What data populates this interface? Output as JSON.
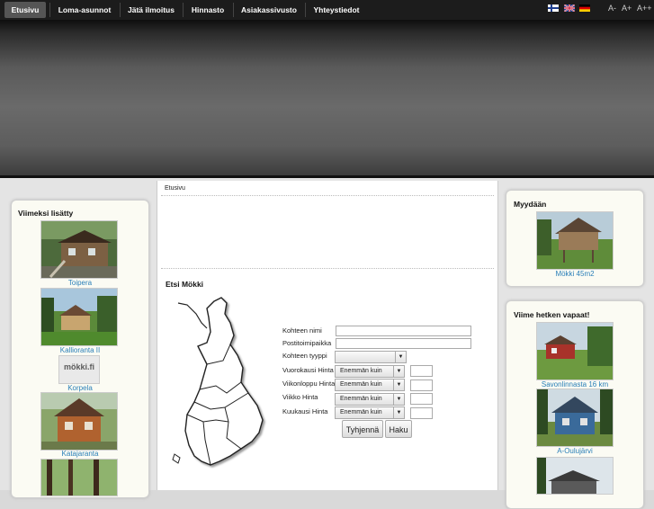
{
  "nav": {
    "items": [
      {
        "label": "Etusivu"
      },
      {
        "label": "Loma-asunnot"
      },
      {
        "label": "Jätä ilmoitus"
      },
      {
        "label": "Hinnasto"
      },
      {
        "label": "Asiakassivusto"
      },
      {
        "label": "Yhteystiedot"
      }
    ],
    "font_sizes": [
      "A-",
      "A+",
      "A++"
    ],
    "languages": [
      "fi-flag-icon",
      "uk-flag-icon",
      "de-flag-icon"
    ]
  },
  "left": {
    "title": "Viimeksi lisätty",
    "items": [
      {
        "caption": "Toipera"
      },
      {
        "caption": "Kallioranta II"
      },
      {
        "caption": "Korpela",
        "logo_text": "mökki.fi"
      },
      {
        "caption": "Katajaranta"
      }
    ]
  },
  "center": {
    "breadcrumb": "Etusivu",
    "search": {
      "title": "Etsi Mökki",
      "fields": [
        {
          "label": "Kohteen nimi",
          "value": ""
        },
        {
          "label": "Postitoimipaikka",
          "value": ""
        },
        {
          "label": "Kohteen tyyppi",
          "value": ""
        }
      ],
      "price_rows": [
        {
          "label": "Vuorokausi Hinta",
          "select": "Enemmän kuin",
          "value": ""
        },
        {
          "label": "Viikonloppu Hinta",
          "select": "Enemmän kuin",
          "value": ""
        },
        {
          "label": "Viikko Hinta",
          "select": "Enemmän kuin",
          "value": ""
        },
        {
          "label": "Kuukausi Hinta",
          "select": "Enemmän kuin",
          "value": ""
        }
      ],
      "clear_label": "Tyhjennä",
      "search_label": "Haku"
    }
  },
  "right": {
    "sale": {
      "title": "Myydään",
      "items": [
        {
          "caption": "Mökki 45m2"
        }
      ]
    },
    "lastminute": {
      "title": "Viime hetken vapaat!",
      "items": [
        {
          "caption": "Savonlinnasta 16 km"
        },
        {
          "caption": "A-Oulujärvi"
        },
        {
          "caption": ""
        }
      ]
    }
  },
  "colors": {
    "nav_bg": "#1c1c1c",
    "link": "#2a7fb8",
    "box_bg": "#fbfbf3"
  }
}
